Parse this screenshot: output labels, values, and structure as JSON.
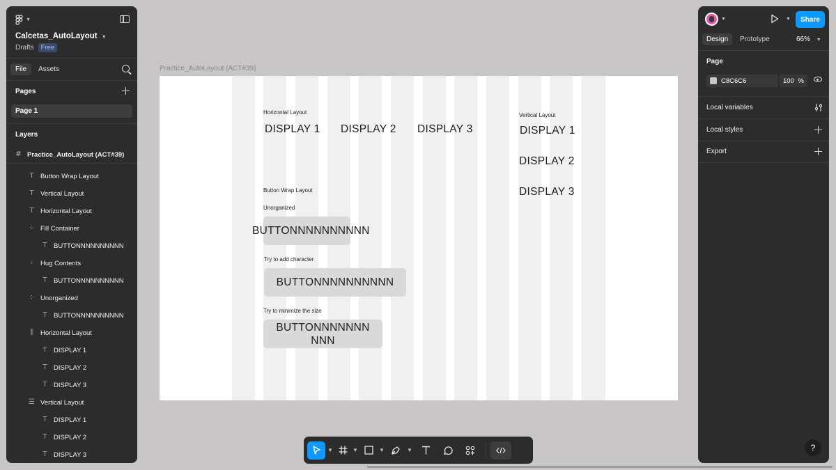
{
  "left_panel": {
    "file_title": "Calcetas_AutoLayout",
    "drafts": "Drafts",
    "plan_badge": "Free",
    "tabs": [
      "File",
      "Assets"
    ],
    "pages_title": "Pages",
    "pages": [
      "Page 1"
    ],
    "layers_title": "Layers",
    "root_frame": "Practice_AutoLayout (ACT#39)",
    "layers": [
      {
        "label": "Button Wrap Layout",
        "icon": "text-icon",
        "glyph": "T",
        "indent": 1
      },
      {
        "label": "Vertical Layout",
        "icon": "text-icon",
        "glyph": "T",
        "indent": 1
      },
      {
        "label": "Horizontal Layout",
        "icon": "text-icon",
        "glyph": "T",
        "indent": 1
      },
      {
        "label": "Fill Container",
        "icon": "component-icon",
        "glyph": "⁘",
        "indent": 1
      },
      {
        "label": "BUTTONNNNNNNNNN",
        "icon": "text-icon",
        "glyph": "T",
        "indent": 2
      },
      {
        "label": "Hug Contents",
        "icon": "component-icon",
        "glyph": "⁘",
        "indent": 1
      },
      {
        "label": "BUTTONNNNNNNNNN",
        "icon": "text-icon",
        "glyph": "T",
        "indent": 2
      },
      {
        "label": "Unorganized",
        "icon": "component-icon",
        "glyph": "⁘",
        "indent": 1
      },
      {
        "label": "BUTTONNNNNNNNNN",
        "icon": "text-icon",
        "glyph": "T",
        "indent": 2
      },
      {
        "label": "Horizontal Layout",
        "icon": "horizontal-autolayout-icon",
        "glyph": "⫼",
        "indent": 1
      },
      {
        "label": "DISPLAY 1",
        "icon": "text-icon",
        "glyph": "T",
        "indent": 2
      },
      {
        "label": "DISPLAY 2",
        "icon": "text-icon",
        "glyph": "T",
        "indent": 2
      },
      {
        "label": "DISPLAY 3",
        "icon": "text-icon",
        "glyph": "T",
        "indent": 2
      },
      {
        "label": "Vertical Layout",
        "icon": "vertical-autolayout-icon",
        "glyph": "☰",
        "indent": 1
      },
      {
        "label": "DISPLAY 1",
        "icon": "text-icon",
        "glyph": "T",
        "indent": 2
      },
      {
        "label": "DISPLAY 2",
        "icon": "text-icon",
        "glyph": "T",
        "indent": 2
      },
      {
        "label": "DISPLAY 3",
        "icon": "text-icon",
        "glyph": "T",
        "indent": 2
      }
    ]
  },
  "canvas": {
    "frame_label": "Practice_AutoLayout (ACT#39)",
    "horizontal_layout_label": "Horizontal Layout",
    "horizontal_items": [
      "DISPLAY 1",
      "DISPLAY 2",
      "DISPLAY 3"
    ],
    "vertical_layout_label": "Vertical Layout",
    "vertical_items": [
      "DISPLAY 1",
      "DISPLAY 2",
      "DISPLAY 3"
    ],
    "button_wrap_label": "Button Wrap Layout",
    "unorganized_label": "Unorganized",
    "unorganized_button": "BUTTONNNNNNNNNN",
    "add_char_label": "Try to add character",
    "add_char_button": "BUTTONNNNNNNNNN",
    "minimize_label": "Try to minimize the size",
    "minimize_button_line1": "BUTTONNNNNNN",
    "minimize_button_line2": "NNN"
  },
  "right_panel": {
    "share": "Share",
    "tabs": [
      "Design",
      "Prototype"
    ],
    "zoom": "66%",
    "page_section": "Page",
    "bg_color": "C8C6C6",
    "opacity": "100",
    "opacity_unit": "%",
    "local_variables": "Local variables",
    "local_styles": "Local styles",
    "export": "Export",
    "help": "?"
  },
  "colors": {
    "panel": "#2c2c2c",
    "canvas_bg": "#c8c6c6",
    "accent": "#0d99ff",
    "column_guides": "#f0f0f0",
    "button_fill": "#d9d9d9"
  }
}
